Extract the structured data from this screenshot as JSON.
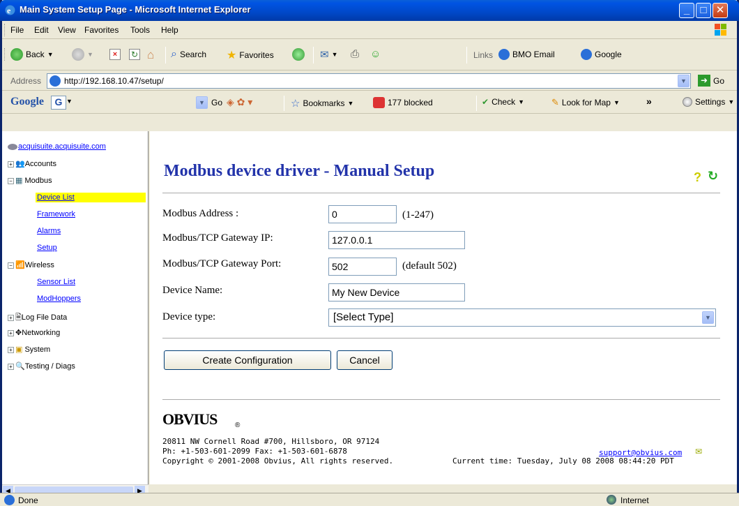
{
  "window": {
    "title": "Main System Setup Page - Microsoft Internet Explorer"
  },
  "menu": [
    "File",
    "Edit",
    "View",
    "Favorites",
    "Tools",
    "Help"
  ],
  "toolbar": {
    "back": "Back",
    "search": "Search",
    "favorites": "Favorites",
    "links": "Links",
    "bmo": "BMO Email",
    "google": "Google"
  },
  "address": {
    "label": "Address",
    "url": "http://192.168.10.47/setup/",
    "go": "Go"
  },
  "googlebar": {
    "logo": "Google",
    "go": "Go",
    "bookmarks": "Bookmarks",
    "blocked": "177 blocked",
    "check": "Check",
    "map": "Look for Map",
    "more": "»",
    "settings": "Settings"
  },
  "sidebar": {
    "root": "acquisuite.acquisuite.com",
    "items": [
      {
        "label": "Accounts"
      },
      {
        "label": "Modbus"
      },
      {
        "label": "Device List"
      },
      {
        "label": "Framework"
      },
      {
        "label": "Alarms"
      },
      {
        "label": "Setup"
      },
      {
        "label": "Wireless"
      },
      {
        "label": "Sensor List"
      },
      {
        "label": "ModHoppers"
      },
      {
        "label": "Log File Data"
      },
      {
        "label": "Networking"
      },
      {
        "label": "System"
      },
      {
        "label": "Testing / Diags"
      }
    ]
  },
  "page": {
    "heading": "Modbus device driver - Manual Setup",
    "fields": {
      "address_label": "Modbus Address :",
      "address_value": "0",
      "address_note": "(1-247)",
      "ip_label": "Modbus/TCP Gateway IP:",
      "ip_value": "127.0.0.1",
      "port_label": "Modbus/TCP Gateway Port:",
      "port_value": "502",
      "port_note": "(default 502)",
      "name_label": "Device Name:",
      "name_value": "My New Device",
      "type_label": "Device type:",
      "type_value": "[Select Type]"
    },
    "buttons": {
      "create": "Create Configuration",
      "cancel": "Cancel"
    },
    "footer": {
      "brand": "OBVIUS",
      "line1": "20811 NW Cornell Road #700, Hillsboro, OR 97124",
      "line2": "Ph: +1-503-601-2099 Fax: +1-503-601-6878",
      "line3": "Copyright © 2001-2008 Obvius, All rights reserved.",
      "email": "support@obvius.com",
      "time": "Current time: Tuesday, July 08 2008 08:44:20 PDT"
    }
  },
  "status": {
    "text": "Done",
    "zone": "Internet"
  }
}
